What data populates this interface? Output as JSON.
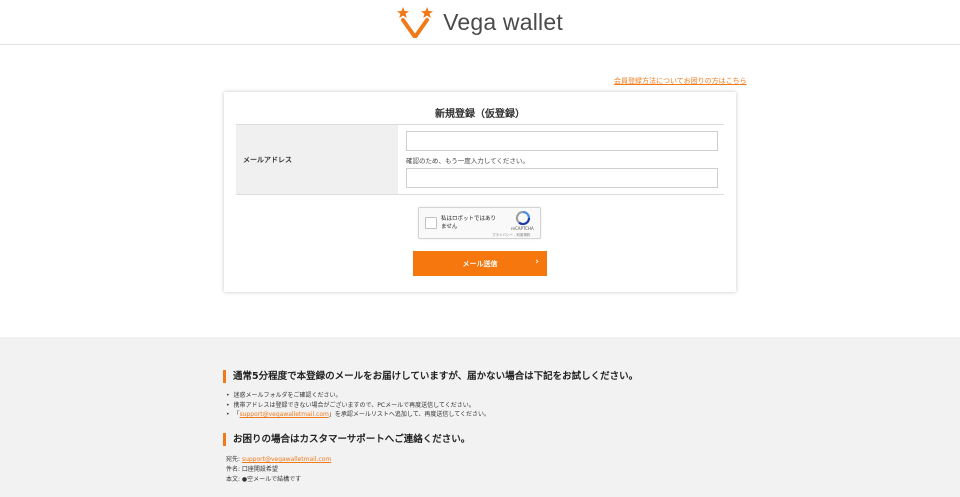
{
  "header": {
    "logo_text": "Vega wallet",
    "colors": {
      "star": "#f07a1a",
      "v_mark": "#f07a1a"
    }
  },
  "help_link": "会員登録方法についてお困りの方はこちら",
  "form": {
    "title": "新規登録（仮登録）",
    "email_label": "メールアドレス",
    "email_value": "",
    "confirm_hint": "確認のため、もう一度入力してください。",
    "confirm_value": "",
    "recaptcha": {
      "label": "私はロボットではありません",
      "brand": "reCAPTCHA",
      "terms": "プライバシー - 利用規約"
    },
    "submit_label": "メール送信",
    "submit_arrow": "›"
  },
  "footer": {
    "heading1": "通常5分程度で本登録のメールをお届けしていますが、届かない場合は下記をお試しください。",
    "bullet1": "迷惑メールフォルダをご確認ください。",
    "bullet2": "携帯アドレスは登録できない場合がございますので、PCメールで再度送信してください。",
    "bullet3_prefix": "「",
    "bullet3_link": "support@vegawalletmail.com",
    "bullet3_suffix": "」を承認メールリストへ追加して、再度送信してください。",
    "heading2": "お困りの場合はカスタマーサポートへご連絡ください。",
    "to_label": "宛先: ",
    "to_link": "support@vegawalletmail.com",
    "subject": "件名: 口座開設希望",
    "body": "本文: ●空メールで結構です"
  },
  "colors": {
    "accent": "#f5770e",
    "footer_bg": "#f2f2f2"
  }
}
